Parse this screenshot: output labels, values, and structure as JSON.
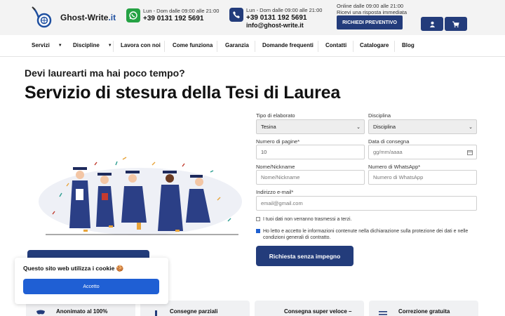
{
  "brand": {
    "name": "Ghost-Write",
    "tld": ".it"
  },
  "contacts": {
    "whatsapp": {
      "hours": "Lun - Dom dalle 09:00 alle 21:00",
      "phone": "+39 0131 192 5691"
    },
    "phone": {
      "hours": "Lun - Dom dalle 09:00 alle 21:00",
      "phone": "+39 0131 192 5691",
      "email": "info@ghost-write.it"
    },
    "online": {
      "line1": "Online dalle 09:00 alle 21:00",
      "line2": "Ricevi una risposta immediata"
    }
  },
  "header": {
    "quote_button": "RICHIEDI PREVENTIVO"
  },
  "nav": [
    "Servizi",
    "Discipline",
    "Lavora con noi",
    "Come funziona",
    "Garanzia",
    "Domande frequenti",
    "Contatti",
    "Catalogare",
    "Blog"
  ],
  "hero": {
    "subtitle": "Devi laurearti ma hai poco tempo?",
    "title": "Servizio di stesura della Tesi di Laurea"
  },
  "form": {
    "tipo_label": "Tipo di elaborato",
    "tipo_value": "Tesina",
    "disciplina_label": "Disciplina",
    "disciplina_value": "Disciplina",
    "pagine_label": "Numero di pagine*",
    "pagine_value": "10",
    "data_label": "Data di consegna",
    "data_placeholder": "gg/mm/aaaa",
    "nome_label": "Nome/Nickname",
    "nome_placeholder": "Nome/Nickname",
    "whatsapp_label": "Numero di WhatsApp*",
    "whatsapp_placeholder": "Numero di WhatsApp",
    "email_label": "Indirizzo e-mail*",
    "email_placeholder": "email@gmail.com",
    "privacy1": "I tuoi dati non verranno trasmessi a terzi.",
    "privacy2": "Ho letto e accetto le informazioni contenute nella dichiarazione sulla protezione dei dati e nelle condizioni generali di contratto.",
    "submit": "Richiesta senza impegno"
  },
  "cookie": {
    "title": "Questo sito web utilizza i cookie 🍪",
    "accept": "Accetto"
  },
  "features": [
    "Anonimato al 100%",
    "Consegne parziali",
    "Consegna super veloce –",
    "Correzione gratuita"
  ],
  "colors": {
    "primary": "#233c7b",
    "accent": "#1f5fd4",
    "whatsapp": "#25a244"
  }
}
